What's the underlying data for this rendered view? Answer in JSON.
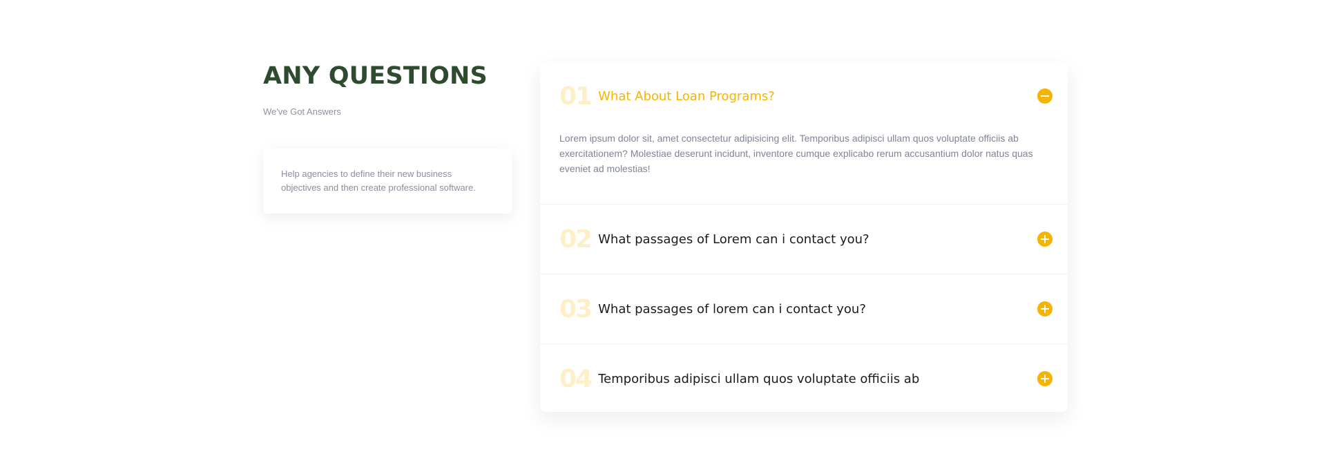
{
  "left": {
    "title": "ANY QUESTIONS",
    "subtitle": "We've Got Answers",
    "card_text": "Help agencies to define their new business objectives and then create professional software."
  },
  "faq": {
    "items": [
      {
        "number": "01",
        "question": "What About Loan Programs?",
        "answer": "Lorem ipsum dolor sit, amet consectetur adipisicing elit. Temporibus adipisci ullam quos voluptate officiis ab exercitationem? Molestiae deserunt incidunt, inventore cumque explicabo rerum accusantium dolor natus quas eveniet ad molestias!",
        "expanded": true
      },
      {
        "number": "02",
        "question": "What passages of Lorem can i contact you?",
        "expanded": false
      },
      {
        "number": "03",
        "question": "What passages of lorem can i contact you?",
        "expanded": false
      },
      {
        "number": "04",
        "question": "Temporibus adipisci ullam quos voluptate officiis ab",
        "expanded": false
      }
    ]
  },
  "icons": {
    "expanded_toggle": "minus-circle-icon",
    "collapsed_toggle": "plus-circle-icon"
  },
  "colors": {
    "title": "#2f4b2f",
    "accent": "#f4b400",
    "number_faded": "#fdf0c9",
    "body_text": "#7f8496"
  }
}
